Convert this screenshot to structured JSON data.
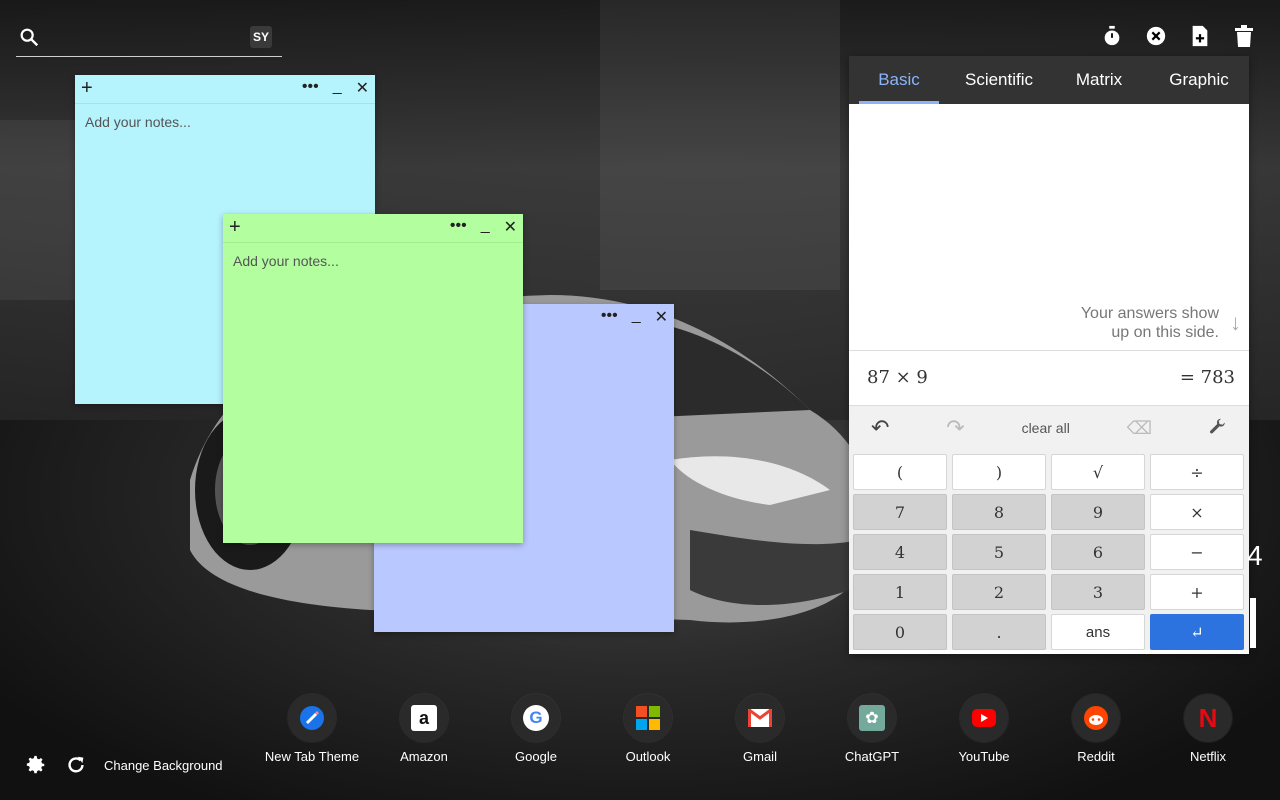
{
  "search": {
    "placeholder": "",
    "badge": "SY"
  },
  "top_tools": [
    {
      "icon": "timer-icon"
    },
    {
      "icon": "close-circle-icon"
    },
    {
      "icon": "add-note-icon"
    },
    {
      "icon": "trash-icon"
    }
  ],
  "notes": [
    {
      "color": "#b5f3fd",
      "placeholder": "Add your notes..."
    },
    {
      "color": "#b3ff9f",
      "placeholder": "Add your notes..."
    },
    {
      "color": "#b9c8fe",
      "placeholder": ""
    }
  ],
  "calculator": {
    "tabs": [
      "Basic",
      "Scientific",
      "Matrix",
      "Graphic"
    ],
    "active_tab": "Basic",
    "hint_line1": "Your answers show",
    "hint_line2": "up on this side.",
    "expression": "87 × 9",
    "result": "= 783",
    "tools": {
      "clear_all": "clear all"
    },
    "keys": [
      "(",
      ")",
      "√",
      "÷",
      "7",
      "8",
      "9",
      "×",
      "4",
      "5",
      "6",
      "−",
      "1",
      "2",
      "3",
      "+",
      "0",
      ".",
      "ans",
      "↵"
    ]
  },
  "peek_text": "4",
  "bottom": {
    "change_background": "Change Background"
  },
  "shortcuts": [
    {
      "label": "New Tab Theme",
      "icon": "new-tab-theme-icon"
    },
    {
      "label": "Amazon",
      "icon": "amazon-icon"
    },
    {
      "label": "Google",
      "icon": "google-icon"
    },
    {
      "label": "Outlook",
      "icon": "outlook-icon"
    },
    {
      "label": "Gmail",
      "icon": "gmail-icon"
    },
    {
      "label": "ChatGPT",
      "icon": "chatgpt-icon"
    },
    {
      "label": "YouTube",
      "icon": "youtube-icon"
    },
    {
      "label": "Reddit",
      "icon": "reddit-icon"
    },
    {
      "label": "Netflix",
      "icon": "netflix-icon"
    }
  ]
}
